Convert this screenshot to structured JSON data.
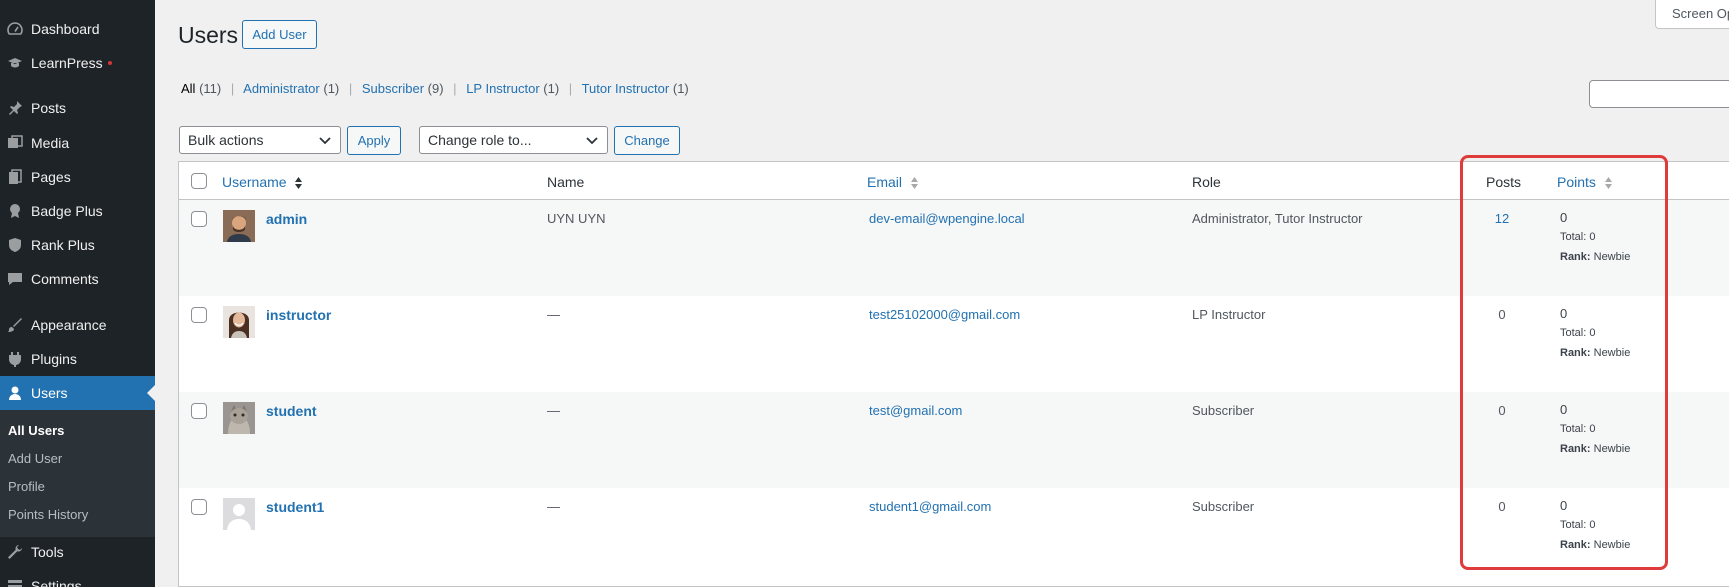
{
  "sidebar": {
    "items": [
      {
        "label": "Dashboard",
        "icon": "dashboard-icon"
      },
      {
        "label": "LearnPress",
        "icon": "graduation-cap-icon",
        "has_notification_dot": true
      },
      {
        "label": "Posts",
        "icon": "pushpin-icon"
      },
      {
        "label": "Media",
        "icon": "media-icon"
      },
      {
        "label": "Pages",
        "icon": "pages-icon"
      },
      {
        "label": "Badge Plus",
        "icon": "badge-icon"
      },
      {
        "label": "Rank Plus",
        "icon": "shield-icon"
      },
      {
        "label": "Comments",
        "icon": "comment-icon"
      },
      {
        "label": "Appearance",
        "icon": "paintbrush-icon"
      },
      {
        "label": "Plugins",
        "icon": "plugin-icon"
      },
      {
        "label": "Users",
        "icon": "user-icon",
        "current": true
      },
      {
        "label": "Tools",
        "icon": "wrench-icon"
      },
      {
        "label": "Settings",
        "icon": "settings-icon"
      }
    ],
    "submenu": [
      "All Users",
      "Add User",
      "Profile",
      "Points History"
    ]
  },
  "header": {
    "title": "Users",
    "add_button": "Add User",
    "screen_options": "Screen Op"
  },
  "filters": [
    {
      "label": "All",
      "count": "(11)",
      "current": true
    },
    {
      "label": "Administrator",
      "count": "(1)"
    },
    {
      "label": "Subscriber",
      "count": "(9)"
    },
    {
      "label": "LP Instructor",
      "count": "(1)"
    },
    {
      "label": "Tutor Instructor",
      "count": "(1)"
    }
  ],
  "bulk": {
    "bulk_actions": "Bulk actions",
    "apply": "Apply",
    "change_role": "Change role to...",
    "change": "Change"
  },
  "table": {
    "columns": {
      "username": "Username",
      "name": "Name",
      "email": "Email",
      "role": "Role",
      "posts": "Posts",
      "points": "Points"
    },
    "rows": [
      {
        "username": "admin",
        "name": "UYN UYN",
        "email": "dev-email@wpengine.local",
        "role": "Administrator, Tutor Instructor",
        "posts": "12",
        "points": "0",
        "total_label": "Total:",
        "total": "0",
        "rank_label": "Rank:",
        "rank": "Newbie",
        "avatar": "photo-man"
      },
      {
        "username": "instructor",
        "name": "—",
        "email": "test25102000@gmail.com",
        "role": "LP Instructor",
        "posts": "0",
        "points": "0",
        "total_label": "Total:",
        "total": "0",
        "rank_label": "Rank:",
        "rank": "Newbie",
        "avatar": "photo-woman"
      },
      {
        "username": "student",
        "name": "—",
        "email": "test@gmail.com",
        "role": "Subscriber",
        "posts": "0",
        "points": "0",
        "total_label": "Total:",
        "total": "0",
        "rank_label": "Rank:",
        "rank": "Newbie",
        "avatar": "photo-cat"
      },
      {
        "username": "student1",
        "name": "—",
        "email": "student1@gmail.com",
        "role": "Subscriber",
        "posts": "0",
        "points": "0",
        "total_label": "Total:",
        "total": "0",
        "rank_label": "Rank:",
        "rank": "Newbie",
        "avatar": "default-avatar"
      }
    ]
  },
  "colors": {
    "sidebar_bg": "#1d2327",
    "accent": "#2271b1",
    "highlight_box": "#e03b3b"
  }
}
